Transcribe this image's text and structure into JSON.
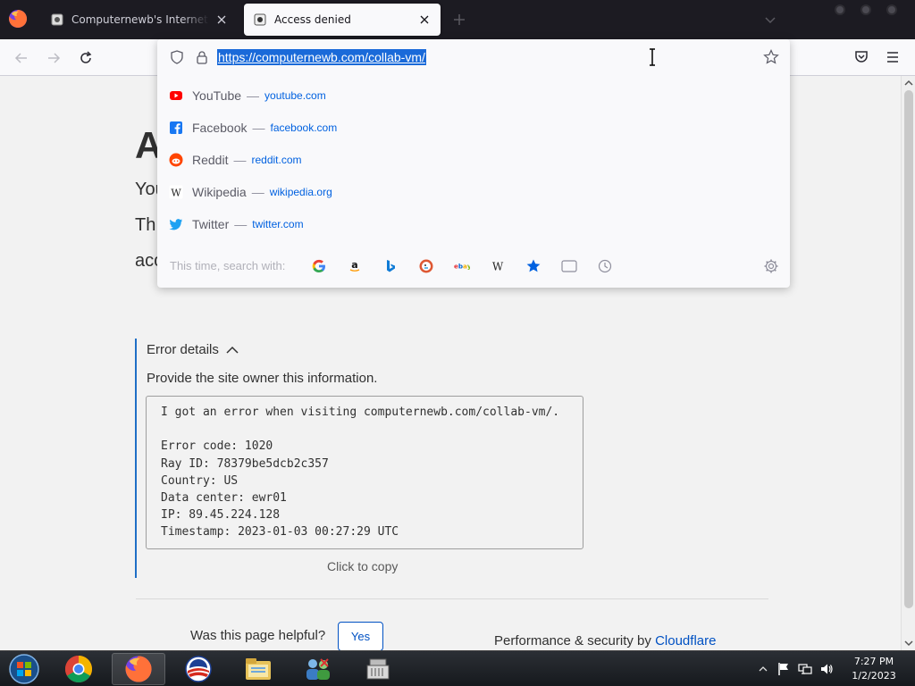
{
  "browser": {
    "tabs": [
      {
        "title": "Computernewb's Internet Pub",
        "active": false
      },
      {
        "title": "Access denied",
        "active": true
      }
    ]
  },
  "urlbar": {
    "url": "https://computernewb.com/collab-vm/",
    "suggestions": [
      {
        "title": "YouTube",
        "url": "youtube.com",
        "icon": "youtube-icon"
      },
      {
        "title": "Facebook",
        "url": "facebook.com",
        "icon": "facebook-icon"
      },
      {
        "title": "Reddit",
        "url": "reddit.com",
        "icon": "reddit-icon"
      },
      {
        "title": "Wikipedia",
        "url": "wikipedia.org",
        "icon": "wikipedia-icon"
      },
      {
        "title": "Twitter",
        "url": "twitter.com",
        "icon": "twitter-icon"
      }
    ],
    "search_with_label": "This time, search with:",
    "engines": [
      "google-icon",
      "amazon-icon",
      "bing-icon",
      "duckduckgo-icon",
      "ebay-icon",
      "wikipedia-icon",
      "bookmarks-icon",
      "tabs-icon",
      "history-icon"
    ]
  },
  "page": {
    "heading_fragment": "A",
    "line1_fragment": "You",
    "line2_fragment": "Th",
    "line3_fragment": "acc",
    "error_details": {
      "summary": "Error details",
      "description": "Provide the site owner this information.",
      "lines": [
        "I got an error when visiting computernewb.com/collab-vm/.",
        "",
        "Error code: 1020",
        "Ray ID: 78379be5dcb2c357",
        "Country: US",
        "Data center: ewr01",
        "IP: 89.45.224.128",
        "Timestamp: 2023-01-03 00:27:29 UTC"
      ],
      "copy_label": "Click to copy"
    },
    "feedback": {
      "question": "Was this page helpful?",
      "yes_label": "Yes"
    },
    "footer": {
      "prefix": "Performance & security by ",
      "brand": "Cloudflare"
    }
  },
  "taskbar": {
    "apps": [
      "start-orb-icon",
      "chrome-icon",
      "firefox-icon",
      "obama-logo-icon",
      "file-explorer-icon",
      "network-users-icon",
      "cash-register-icon"
    ],
    "clock": {
      "time": "7:27 PM",
      "date": "1/2/2023"
    }
  },
  "colors": {
    "accent": "#0051c3",
    "selection": "#1a6ad9",
    "tabstrip": "#1c1b22"
  }
}
